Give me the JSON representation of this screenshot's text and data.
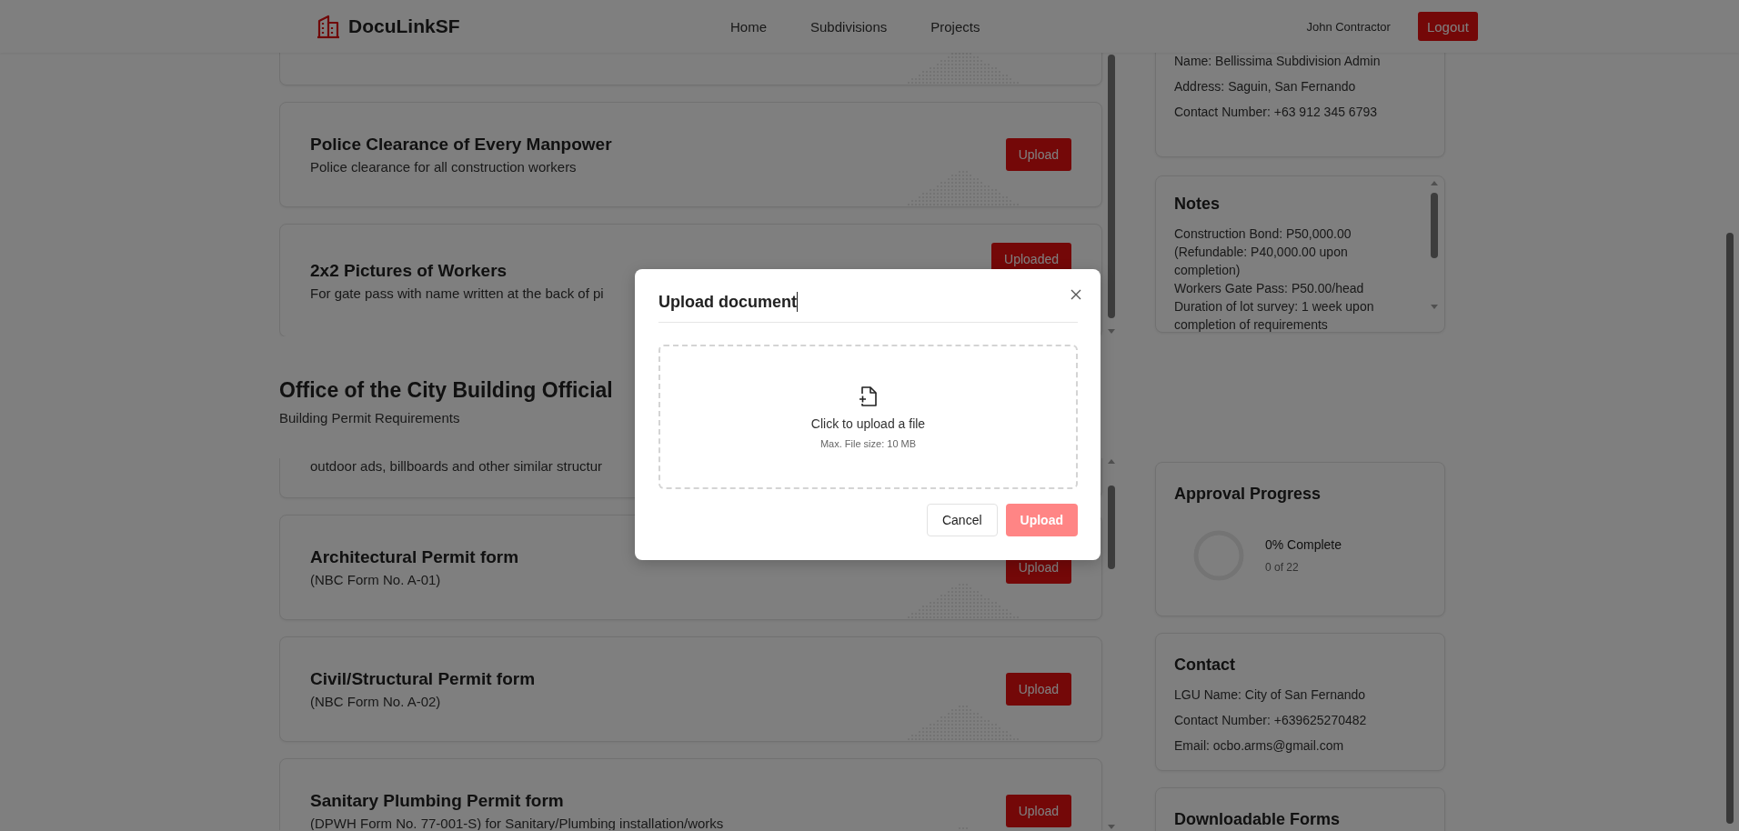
{
  "header": {
    "brand": "DocuLinkSF",
    "nav": [
      {
        "label": "Home"
      },
      {
        "label": "Subdivisions"
      },
      {
        "label": "Projects"
      }
    ],
    "user": "John Contractor",
    "logout": "Logout"
  },
  "sections": [
    {
      "cards": [
        {
          "kind": "partial"
        },
        {
          "title": "Police Clearance of Every Manpower",
          "description": "Police clearance for all construction workers",
          "action": "Upload"
        },
        {
          "title": "2x2 Pictures of Workers",
          "description": "For gate pass with name written at the back of pi",
          "action": "Uploaded"
        }
      ]
    },
    {
      "title": "Office of the City Building Official",
      "subtitle": "Building Permit Requirements",
      "cards": [
        {
          "kind": "partial",
          "description": "outdoor ads, billboards and other similar structur"
        },
        {
          "title": "Architectural Permit form",
          "description": "(NBC Form No. A-01)",
          "action": "Upload"
        },
        {
          "title": "Civil/Structural Permit form",
          "description": "(NBC Form No. A-02)",
          "action": "Upload"
        },
        {
          "title": "Sanitary Plumbing Permit form",
          "description": "(DPWH Form No. 77-001-S) for Sanitary/Plumbing installation/works",
          "action": "Upload"
        }
      ]
    }
  ],
  "sidebar": {
    "info": {
      "lines": [
        "Name: Bellissima Subdivision Admin",
        "Address: Saguin, San Fernando",
        "Contact Number: +63 912 345 6793"
      ]
    },
    "notes": {
      "title": "Notes",
      "lines": [
        "Construction Bond: P50,000.00 (Refundable: P40,000.00 upon completion)",
        "Workers Gate Pass: P50.00/head",
        "Duration of lot survey: 1 week upon completion of requirements"
      ]
    },
    "progress": {
      "title": "Approval Progress",
      "level": 0,
      "percent": "0% Complete",
      "count": "0 of 22"
    },
    "contact": {
      "title": "Contact",
      "lines": [
        "LGU Name: City of San Fernando",
        "Contact Number: +639625270482",
        "Email: ocbo.arms@gmail.com"
      ]
    },
    "downloads": {
      "title": "Downloadable Forms"
    }
  },
  "modal": {
    "title": "Upload document",
    "drop_label": "Click to upload a file",
    "drop_hint": "Max. File size: 10 MB",
    "cancel": "Cancel",
    "submit": "Upload"
  }
}
